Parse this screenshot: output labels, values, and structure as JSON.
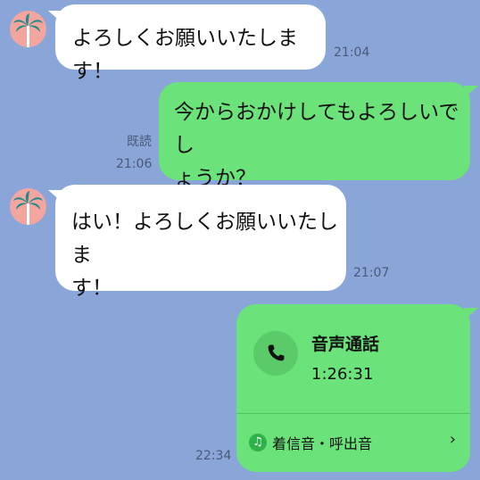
{
  "messages": [
    {
      "text": "よろしくお願いいたします！",
      "time": "21:04"
    },
    {
      "text_line1": "今からおかけしてもよろしいでし",
      "text_line2": "ょうか？",
      "read": "既読",
      "time": "21:06"
    },
    {
      "text_line1": "はい！よろしくお願いいたしま",
      "text_line2": "す！",
      "time": "21:07"
    }
  ],
  "call": {
    "title": "音声通話",
    "duration": "1:26:31",
    "ringtone_label": "着信音・呼出音",
    "chevron": "›",
    "time": "22:34",
    "icon": "phone-icon",
    "music_icon_glyph": "♫"
  },
  "colors": {
    "background": "#8aa5d8",
    "outgoing_bubble": "#6ce27a",
    "incoming_bubble": "#ffffff",
    "avatar": "#f3a5a0"
  }
}
